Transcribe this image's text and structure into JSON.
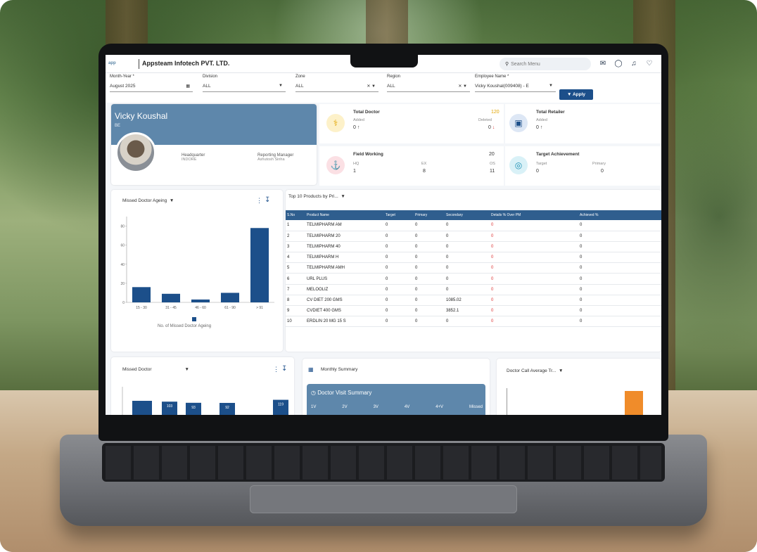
{
  "app": {
    "company": "Appsteam Infotech PVT. LTD.",
    "search_placeholder": "Search Menu"
  },
  "filters": {
    "month_year_label": "Month-Year *",
    "month_year_value": "August 2025",
    "division_label": "Division",
    "division_value": "ALL",
    "zone_label": "Zone",
    "zone_value": "ALL",
    "region_label": "Region",
    "region_value": "ALL",
    "employee_label": "Employee Name *",
    "employee_value": "Vicky Koushal(009408) - E",
    "apply_label": "Apply"
  },
  "profile": {
    "name": "Vicky Koushal",
    "role": "BE",
    "hq_label": "Headquarter",
    "hq_value": "INDORE",
    "manager_label": "Reporting Manager",
    "manager_value": "Ashutosh Sinha"
  },
  "kpis": {
    "total_doctor": {
      "title": "Total Doctor",
      "added_label": "Added",
      "added_value": "0",
      "right_value": "120",
      "deleted_label": "Deleted",
      "deleted_value": "0"
    },
    "total_retailer": {
      "title": "Total Retailer",
      "added_label": "Added",
      "added_value": "0"
    },
    "field_working": {
      "title": "Field Working",
      "hq_label": "HQ",
      "hq_value": "1",
      "ex_label": "EX",
      "ex_value": "8",
      "right_value": "20",
      "os_label": "OS",
      "os_value": "11"
    },
    "target_achievement": {
      "title": "Target Achievement",
      "target_label": "Target",
      "target_value": "0",
      "primary_label": "Primary",
      "primary_value": "0"
    }
  },
  "missed_ageing": {
    "title": "Missed Doctor Ageing",
    "legend": "No. of Missed Doctor Ageing"
  },
  "chart_data": [
    {
      "type": "bar",
      "title": "Missed Doctor Ageing",
      "categories": [
        "15 - 30",
        "31 - 45",
        "46 - 60",
        "61 - 90",
        "> 91"
      ],
      "values": [
        16,
        9,
        3,
        10,
        78
      ],
      "ylim": [
        0,
        90
      ],
      "yticks": [
        0,
        20,
        40,
        60,
        80
      ]
    },
    {
      "type": "bar",
      "title": "Missed Doctor",
      "values": [
        103,
        93,
        92,
        119
      ],
      "ylim": [
        0,
        120
      ]
    }
  ],
  "products": {
    "title": "Top 10 Products by Pri...",
    "columns": [
      "S.No",
      "Product Name",
      "Target",
      "Primary",
      "Secondary",
      "Details % Over PM",
      "Achieved %"
    ],
    "rows": [
      [
        "1",
        "TELMIPHARM AM",
        "0",
        "0",
        "0",
        "0",
        "0"
      ],
      [
        "2",
        "TELMIPHARM 20",
        "0",
        "0",
        "0",
        "0",
        "0"
      ],
      [
        "3",
        "TELMIPHARM 40",
        "0",
        "0",
        "0",
        "0",
        "0"
      ],
      [
        "4",
        "TELMIPHARM H",
        "0",
        "0",
        "0",
        "0",
        "0"
      ],
      [
        "5",
        "TELMIPHARM AMH",
        "0",
        "0",
        "0",
        "0",
        "0"
      ],
      [
        "6",
        "URL PLUS",
        "0",
        "0",
        "0",
        "0",
        "0"
      ],
      [
        "7",
        "MELOOLIZ",
        "0",
        "0",
        "0",
        "0",
        "0"
      ],
      [
        "8",
        "CV DIET 200 GMS",
        "0",
        "0",
        "1085.02",
        "0",
        "0"
      ],
      [
        "9",
        "CVDIET 400 GMS",
        "0",
        "0",
        "3852.1",
        "0",
        "0"
      ],
      [
        "10",
        "ERDLIN 20 MG 15 S",
        "0",
        "0",
        "0",
        "0",
        "0"
      ]
    ]
  },
  "missed_doctor": {
    "title": "Missed Doctor"
  },
  "monthly_summary": {
    "title": "Monthly Summary",
    "subtitle": "Doctor Visit Summary",
    "cols": [
      "1V",
      "2V",
      "3V",
      "4V",
      "4+V",
      "Missed"
    ]
  },
  "call_average": {
    "title": "Doctor Call Average Tr..."
  }
}
